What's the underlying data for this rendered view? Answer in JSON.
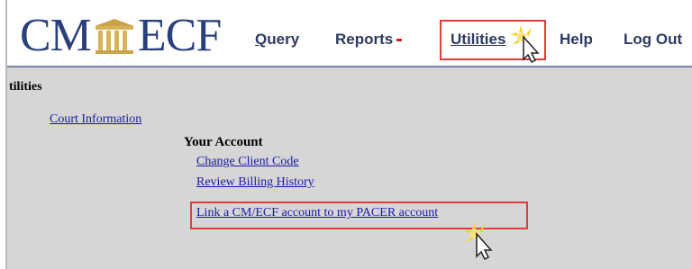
{
  "logo": {
    "left": "CM",
    "right": "ECF"
  },
  "nav": {
    "query": {
      "underlined": "Q",
      "rest": "uery"
    },
    "reports": "Reports",
    "utilities": {
      "underlined": "Utilities"
    },
    "help": "Help",
    "logout": "Log Out"
  },
  "page": {
    "title": "tilities",
    "court_information": "Court Information",
    "your_account": "Your Account",
    "change_client_code": "Change Client Code",
    "review_billing_history": "Review Billing History",
    "link_account": "Link a CM/ECF account to my PACER account"
  },
  "colors": {
    "brand_navy": "#2b3f7a",
    "highlight_red": "#e23b3b",
    "link_blue": "#1a1aa8",
    "content_gray": "#d6d6d6"
  }
}
